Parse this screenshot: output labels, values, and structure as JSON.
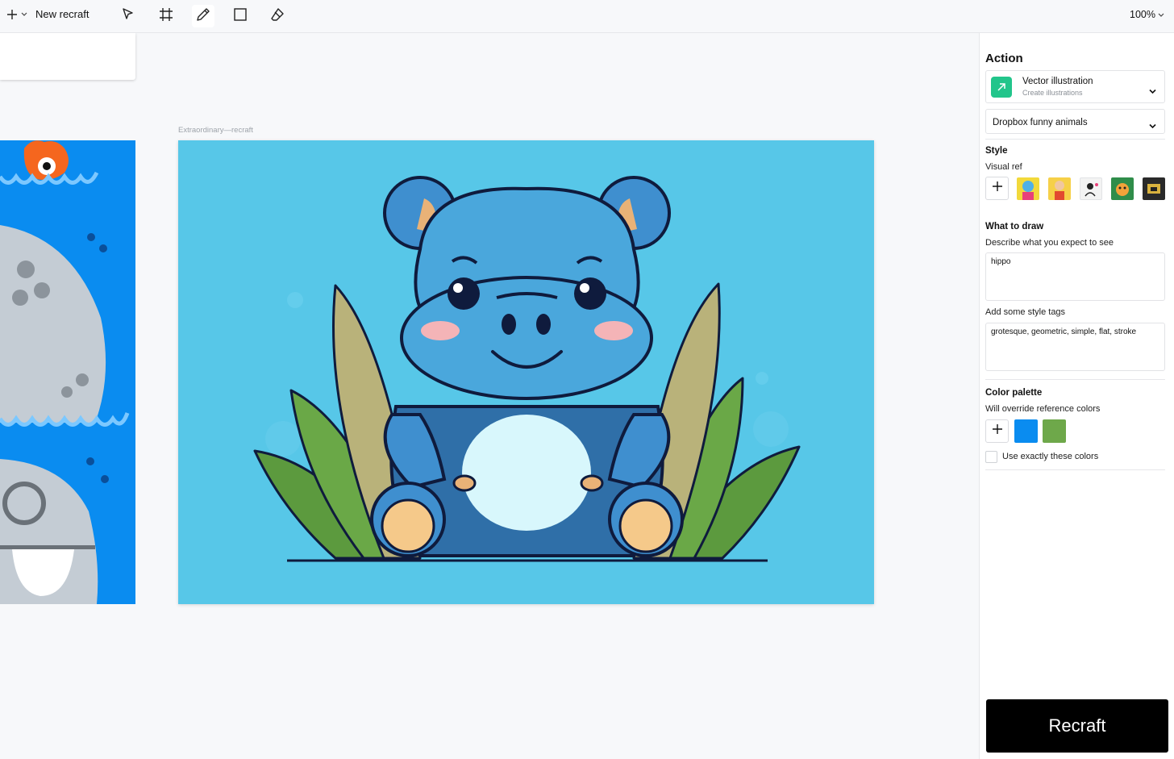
{
  "toolbar": {
    "new_label": "New recraft",
    "zoom": "100%",
    "tools": [
      {
        "name": "select-tool",
        "icon": "cursor-arrow-icon"
      },
      {
        "name": "frame-tool",
        "icon": "frame-icon"
      },
      {
        "name": "pencil-tool",
        "icon": "pencil-icon"
      },
      {
        "name": "rectangle-tool",
        "icon": "square-icon"
      },
      {
        "name": "eraser-tool",
        "icon": "eraser-icon"
      }
    ]
  },
  "canvas": {
    "frame_label": "Extraordinary—recraft",
    "colors": {
      "left_art_bg": "#0a8cf0",
      "main_art_bg": "#57c7e8"
    }
  },
  "panel": {
    "action_title": "Action",
    "action": {
      "name": "Vector illustration",
      "subtitle": "Create illustrations",
      "color": "#22c58b"
    },
    "model": "Dropbox funny animals",
    "style_title": "Style",
    "visual_ref_label": "Visual ref",
    "what_to_draw_title": "What to draw",
    "describe_label": "Describe what you expect to see",
    "prompt_value": "hippo",
    "style_tags_label": "Add some style tags",
    "style_tags_value": "grotesque, geometric, simple, flat, stroke",
    "color_palette_title": "Color palette",
    "color_palette_subtitle": "Will override reference colors",
    "palette_colors": [
      "#0a8cf0",
      "#6ea84a"
    ],
    "use_exact_label": "Use exactly these colors",
    "submit_label": "Recraft"
  }
}
